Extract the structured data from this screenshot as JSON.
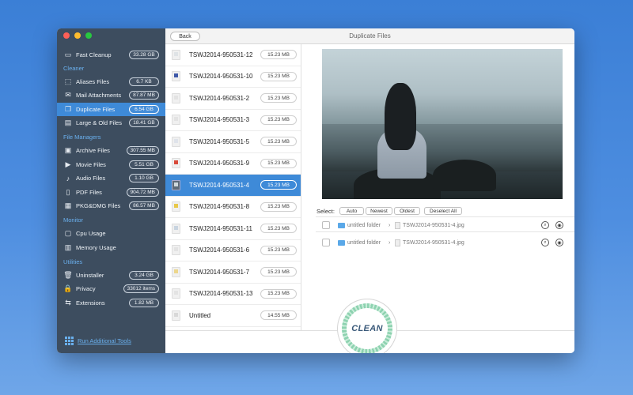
{
  "window": {
    "title": "Duplicate Files",
    "back_label": "Back"
  },
  "colors": {
    "accent": "#3e8ad8",
    "sidebar": "#3d4d5f",
    "section_header": "#6ab0ee"
  },
  "sidebar": {
    "fast_cleanup": {
      "label": "Fast Cleanup",
      "badge": "33.28 GB",
      "icon": "monitor-icon"
    },
    "sections": {
      "cleaner": "Cleaner",
      "file_managers": "File Managers",
      "monitor": "Monitor",
      "utilities": "Utilities"
    },
    "cleaner_items": [
      {
        "label": "Aliases Files",
        "badge": "6.7 KB",
        "icon": "alias-icon"
      },
      {
        "label": "Mail Attachments",
        "badge": "87.87 MB",
        "icon": "mail-icon"
      },
      {
        "label": "Duplicate Files",
        "badge": "6.54 GB",
        "icon": "duplicate-icon"
      },
      {
        "label": "Large & Old Files",
        "badge": "18.41 GB",
        "icon": "large-files-icon"
      }
    ],
    "file_manager_items": [
      {
        "label": "Archive Files",
        "badge": "307.55 MB",
        "icon": "archive-icon"
      },
      {
        "label": "Movie Files",
        "badge": "5.51 GB",
        "icon": "movie-icon"
      },
      {
        "label": "Audio Files",
        "badge": "1.10 GB",
        "icon": "audio-icon"
      },
      {
        "label": "PDF Files",
        "badge": "904.72 MB",
        "icon": "pdf-icon"
      },
      {
        "label": "PKG&DMG Files",
        "badge": "86.57 MB",
        "icon": "package-icon"
      }
    ],
    "monitor_items": [
      {
        "label": "Cpu Usage",
        "icon": "cpu-icon"
      },
      {
        "label": "Memory Usage",
        "icon": "memory-icon"
      }
    ],
    "utility_items": [
      {
        "label": "Uninstaller",
        "badge": "3.24 GB",
        "icon": "trash-icon"
      },
      {
        "label": "Privacy",
        "badge": "33012 items",
        "icon": "lock-icon"
      },
      {
        "label": "Extensions",
        "badge": "1.82 MB",
        "icon": "extensions-icon"
      }
    ],
    "run_tools": "Run Additional Tools"
  },
  "files": [
    {
      "name": "TSWJ2014-950531-12",
      "size": "15.23 MB"
    },
    {
      "name": "TSWJ2014-950531-10",
      "size": "15.23 MB"
    },
    {
      "name": "TSWJ2014-950531-2",
      "size": "15.23 MB"
    },
    {
      "name": "TSWJ2014-950531-3",
      "size": "15.23 MB"
    },
    {
      "name": "TSWJ2014-950531-5",
      "size": "15.23 MB"
    },
    {
      "name": "TSWJ2014-950531-9",
      "size": "15.23 MB"
    },
    {
      "name": "TSWJ2014-950531-4",
      "size": "15.23 MB"
    },
    {
      "name": "TSWJ2014-950531-8",
      "size": "15.23 MB"
    },
    {
      "name": "TSWJ2014-950531-11",
      "size": "15.23 MB"
    },
    {
      "name": "TSWJ2014-950531-6",
      "size": "15.23 MB"
    },
    {
      "name": "TSWJ2014-950531-7",
      "size": "15.23 MB"
    },
    {
      "name": "TSWJ2014-950531-13",
      "size": "15.23 MB"
    },
    {
      "name": "Untitled",
      "size": "14.55 MB"
    }
  ],
  "select": {
    "label": "Select:",
    "auto": "Auto",
    "newest": "Newest",
    "oldest": "Oldest",
    "deselect": "Deselect All"
  },
  "duplicates": [
    {
      "folder": "untitled folder",
      "file": "TSWJ2014-950531-4.jpg"
    },
    {
      "folder": "untitled folder",
      "file": "TSWJ2014-950531-4.jpg"
    }
  ],
  "clean_label": "CLEAN"
}
